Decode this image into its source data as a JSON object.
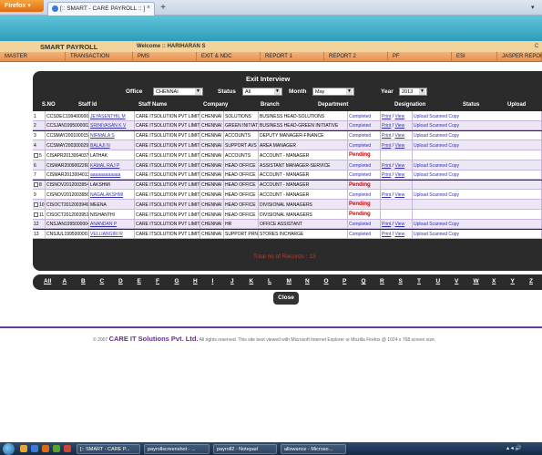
{
  "browser": {
    "firefox_label": "Firefox",
    "tab_title": "[:: SMART - CARE PAYROLL :: ]",
    "tab_close": "×",
    "new_tab": "+",
    "corner": "▾"
  },
  "header": {
    "app_title": "SMART PAYROLL",
    "welcome": "Welcome :: HARIHARAN S",
    "corner_icon": "C"
  },
  "nav": [
    {
      "label": "MASTER"
    },
    {
      "label": "TRANSACTION"
    },
    {
      "label": "PMS"
    },
    {
      "label": "EXIT & NDC"
    },
    {
      "label": "REPORT 1"
    },
    {
      "label": "REPORT 2"
    },
    {
      "label": "PF"
    },
    {
      "label": "ESI"
    },
    {
      "label": "JASPER REPORTS"
    }
  ],
  "panel": {
    "title": "Exit Interview",
    "filters": {
      "office_label": "Office",
      "office_value": "CHENNAI",
      "status_label": "Status",
      "status_value": "All",
      "month_label": "Month",
      "month_value": "May",
      "year_label": "Year",
      "year_value": "2013"
    },
    "columns": [
      "S.NO",
      "Staff Id",
      "Staff Name",
      "Company",
      "Branch",
      "Department",
      "Designation",
      "Status",
      "Upload"
    ],
    "rows": [
      {
        "sno": "1",
        "id": "CCSDEC1994000001",
        "name": "JEYASENTHIL M",
        "name_link": true,
        "company": "CARE ITSOLUTION PVT LIMITED",
        "branch": "CHENNAI",
        "unit": "SOLUTIONS",
        "dept": "BUSINESS HEAD-SOLUTIONS",
        "status": "Completed",
        "pending": false,
        "print": "Print",
        "view": "View",
        "upload": "Upload Scanned Copy",
        "checkbox": false
      },
      {
        "sno": "2",
        "id": "CCSJAN1995000003",
        "name": "SRINIVASAN K V",
        "name_link": true,
        "company": "CARE ITSOLUTION PVT LIMITED",
        "branch": "CHENNAI",
        "unit": "GREEN INITIATIVE",
        "dept": "BUSINESS HEAD-GREEN INITIATIVE",
        "status": "Completed",
        "pending": false,
        "print": "Print",
        "view": "View",
        "upload": "Upload Scanned Copy",
        "checkbox": false
      },
      {
        "sno": "3",
        "id": "CCSMAY2001000150",
        "name": "NIRMALA S",
        "name_link": true,
        "company": "CARE ITSOLUTION PVT LIMITED",
        "branch": "CHENNAI",
        "unit": "ACCOUNTS",
        "dept": "DEPUTY MANAGER-FINANCE",
        "status": "Completed",
        "pending": false,
        "print": "Print",
        "view": "View",
        "upload": "Upload Scanned Copy",
        "checkbox": false
      },
      {
        "sno": "4",
        "id": "CCSMAY2003000298",
        "name": "BALAJI N",
        "name_link": true,
        "company": "CARE ITSOLUTION PVT LIMITED",
        "branch": "CHENNAI",
        "unit": "SUPPORT AVS",
        "dept": "AREA MANAGER",
        "status": "Completed",
        "pending": false,
        "print": "Print",
        "view": "View",
        "upload": "Upload Scanned Copy",
        "checkbox": false
      },
      {
        "sno": "5",
        "id": "CISAPR2013004037",
        "name": "LATHAK",
        "name_link": false,
        "company": "CARE ITSOLUTION PVT LIMITED",
        "branch": "CHENNAI",
        "unit": "ACCOUNTS",
        "dept": "ACCOUNT - MANAGER",
        "status": "Pending",
        "pending": true,
        "print": "",
        "view": "",
        "upload": "",
        "checkbox": true
      },
      {
        "sno": "6",
        "id": "CISMAR2009002260",
        "name": "KAMAL RAJ P",
        "name_link": true,
        "company": "CARE ITSOLUTION PVT LIMITED",
        "branch": "CHENNAI",
        "unit": "HEAD OFFICE",
        "dept": "ASSISTANT MANAGER-SERVICE",
        "status": "Completed",
        "pending": false,
        "print": "Print",
        "view": "View",
        "upload": "Upload Scanned Copy",
        "checkbox": false
      },
      {
        "sno": "7",
        "id": "CISMAR2013004013",
        "name": "aaaaaaaaaaaa",
        "name_link": true,
        "company": "CARE ITSOLUTION PVT LIMITED",
        "branch": "CHENNAI",
        "unit": "HEAD OFFICE",
        "dept": "ACCOUNT - MANAGER",
        "status": "Completed",
        "pending": false,
        "print": "Print",
        "view": "View",
        "upload": "Upload Scanned Copy",
        "checkbox": false
      },
      {
        "sno": "8",
        "id": "CISNOV2012003954",
        "name": "LAKSHMI",
        "name_link": false,
        "company": "CARE ITSOLUTION PVT LIMITED",
        "branch": "CHENNAI",
        "unit": "HEAD OFFICE",
        "dept": "ACCOUNT - MANAGER",
        "status": "Pending",
        "pending": true,
        "print": "",
        "view": "",
        "upload": "",
        "checkbox": true
      },
      {
        "sno": "9",
        "id": "CISNOV2012003956",
        "name": "NAGALAKSHMI",
        "name_link": true,
        "company": "CARE ITSOLUTION PVT LIMITED",
        "branch": "CHENNAI",
        "unit": "HEAD OFFICE",
        "dept": "ACCOUNT - MANAGER",
        "status": "Completed",
        "pending": false,
        "print": "Print",
        "view": "View",
        "upload": "Upload Scanned Copy",
        "checkbox": false
      },
      {
        "sno": "10",
        "id": "CISOCT2012003949",
        "name": "MEENA",
        "name_link": false,
        "company": "CARE ITSOLUTION PVT LIMITED",
        "branch": "CHENNAI",
        "unit": "HEAD OFFICE",
        "dept": "DIVISIONAL MANAGERS",
        "status": "Pending",
        "pending": true,
        "print": "",
        "view": "",
        "upload": "",
        "checkbox": true
      },
      {
        "sno": "11",
        "id": "CISOCT2012003951",
        "name": "NISHANTHI",
        "name_link": false,
        "company": "CARE ITSOLUTION PVT LIMITED",
        "branch": "CHENNAI",
        "unit": "HEAD OFFICE",
        "dept": "DIVISIONAL MANAGERS",
        "status": "Pending",
        "pending": true,
        "print": "",
        "view": "",
        "upload": "",
        "checkbox": true
      },
      {
        "sno": "12",
        "id": "CNSJAN1995000004",
        "name": "ANANDAN P",
        "name_link": true,
        "company": "CARE ITSOLUTION PVT LIMITED",
        "branch": "CHENNAI",
        "unit": "HR",
        "dept": "OFFICE ASSISTANT",
        "status": "Completed",
        "pending": false,
        "print": "Print",
        "view": "View",
        "upload": "Upload Scanned Copy",
        "checkbox": false
      },
      {
        "sno": "13",
        "id": "CNSJUL1995000007",
        "name": "VELLIANGIRI R",
        "name_link": true,
        "company": "CARE ITSOLUTION PVT LIMITED",
        "branch": "CHENNAI",
        "unit": "SUPPORT PRN",
        "dept": "STORES INCHARGE",
        "status": "Completed",
        "pending": false,
        "print": "Print",
        "view": "View",
        "upload": "Upload Scanned Copy",
        "checkbox": false
      }
    ],
    "total_text": "Total no of Records : 13"
  },
  "alphabet": [
    "All",
    "A",
    "B",
    "C",
    "D",
    "E",
    "F",
    "G",
    "H",
    "I",
    "J",
    "K",
    "L",
    "M",
    "N",
    "O",
    "P",
    "Q",
    "R",
    "S",
    "T",
    "U",
    "V",
    "W",
    "X",
    "Y",
    "Z"
  ],
  "close_label": "Close",
  "footer": {
    "copyright": "© 2007",
    "company": "CARE IT Solutions Pvt. Ltd.",
    "notice": "All rights reserved.  This site best viewed with Microsoft Internet Explorer or Mozilla Firefox @ 1024 x 768 screen size."
  },
  "taskbar": {
    "tasks": [
      "[:: SMART - CARE P...",
      "payrollscreenshot - ...",
      "payroll2 - Notepad",
      "allowance - Microso..."
    ],
    "time": "▴ ◂ 🔊"
  },
  "colors": {
    "panel_bg": "#2b2b2b",
    "row_odd": "#ffffff",
    "row_even": "#ece6f5",
    "pending": "#d00000",
    "link": "#3333aa",
    "nav": "#e8924f",
    "header": "#2a9ab6"
  }
}
